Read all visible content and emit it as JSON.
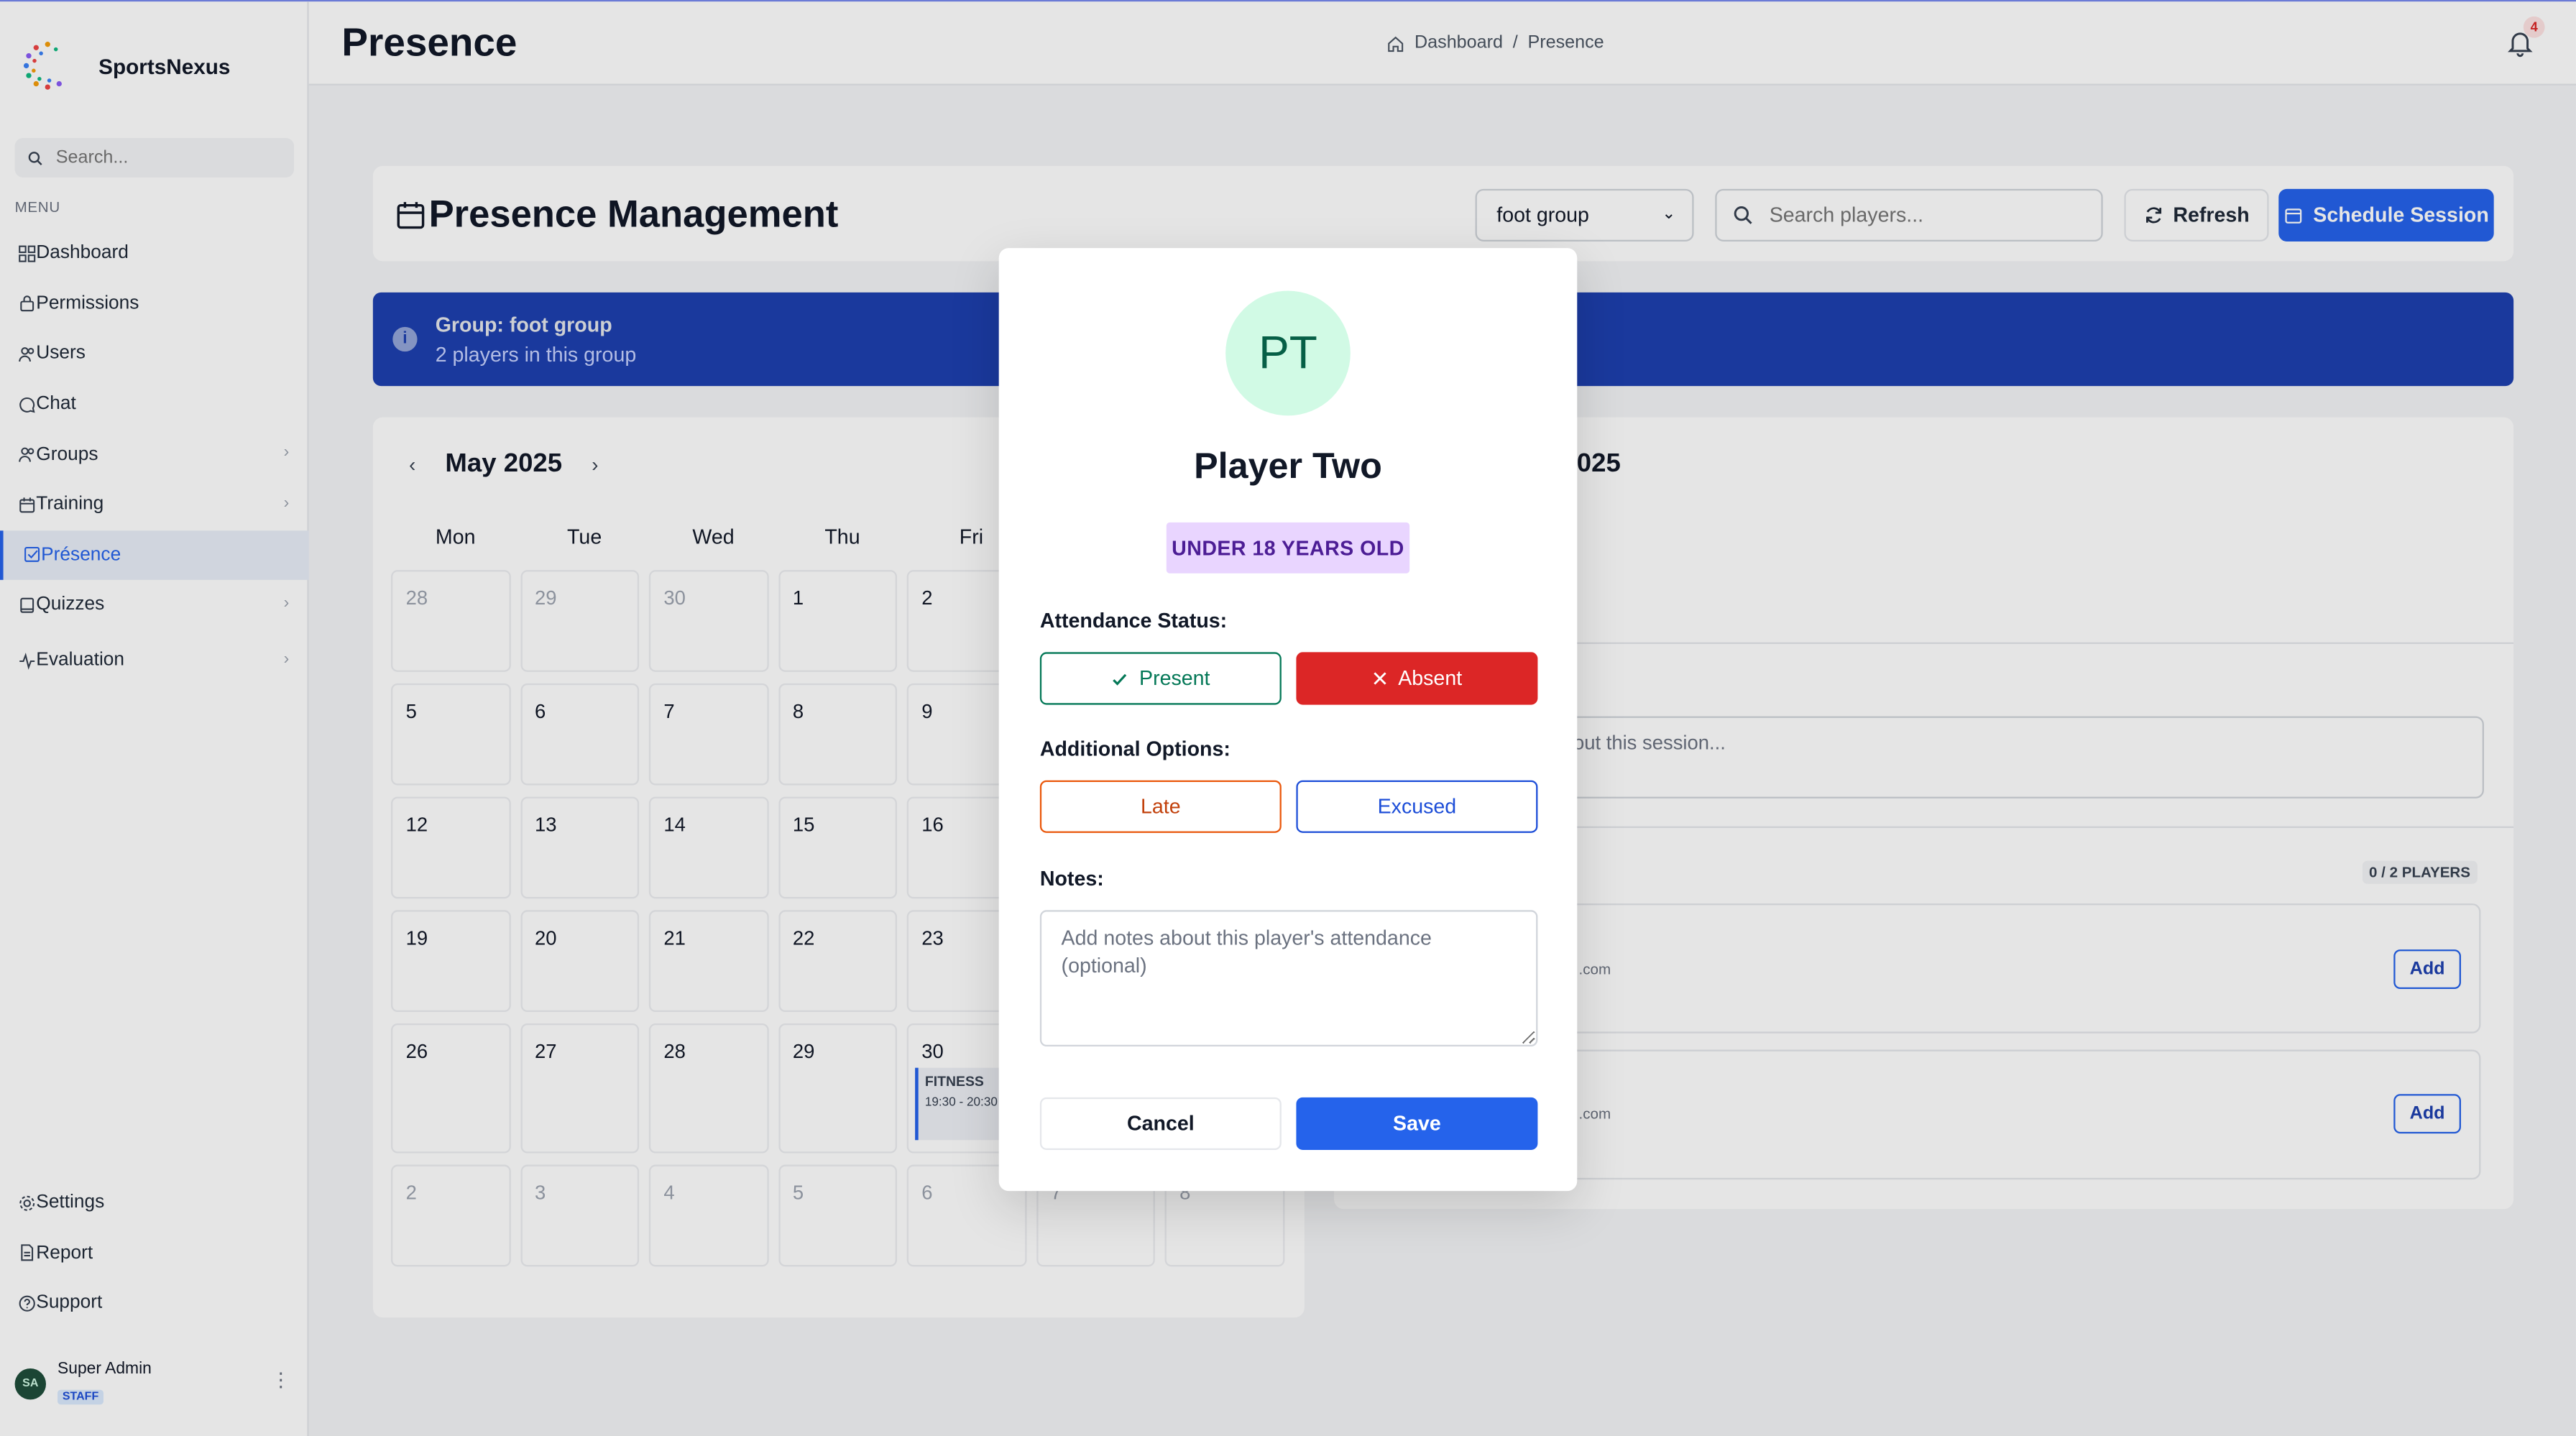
{
  "app": {
    "name": "SportsNexus"
  },
  "colors": {
    "accent": "#2563eb",
    "banner": "#1e40af",
    "danger": "#dc2626",
    "success": "#047857",
    "purple_badge": "#e9d5ff"
  },
  "sidebar": {
    "search_placeholder": "Search...",
    "menu_label": "MENU",
    "items": [
      {
        "label": "Dashboard",
        "icon": "dashboard-icon"
      },
      {
        "label": "Permissions",
        "icon": "lock-icon"
      },
      {
        "label": "Users",
        "icon": "users-icon"
      },
      {
        "label": "Chat",
        "icon": "chat-icon"
      },
      {
        "label": "Groups",
        "icon": "users-icon",
        "has_children": true
      },
      {
        "label": "Training",
        "icon": "calendar-icon",
        "has_children": true
      },
      {
        "label": "Présence",
        "icon": "check-square-icon",
        "active": true
      },
      {
        "label": "Quizzes",
        "icon": "book-icon",
        "has_children": true
      },
      {
        "label": "Evaluation",
        "icon": "activity-icon",
        "has_children": true
      }
    ],
    "bottom_items": [
      {
        "label": "Settings",
        "icon": "gear-icon"
      },
      {
        "label": "Report",
        "icon": "file-icon"
      },
      {
        "label": "Support",
        "icon": "help-icon"
      }
    ],
    "user": {
      "initials": "SA",
      "name": "Super Admin",
      "role": "STAFF"
    }
  },
  "header": {
    "title": "Presence",
    "breadcrumb": [
      "Dashboard",
      "Presence"
    ],
    "notification_count": "4"
  },
  "main": {
    "title": "Presence Management",
    "group_select": "foot group",
    "search_placeholder": "Search players...",
    "refresh_label": "Refresh",
    "schedule_label": "Schedule Session",
    "banner": {
      "title": "Group: foot group",
      "subtitle": "2 players in this group"
    }
  },
  "calendar": {
    "month": "May 2025",
    "weekdays": [
      "Mon",
      "Tue",
      "Wed",
      "Thu",
      "Fri"
    ],
    "weeks": [
      [
        "28",
        "29",
        "30",
        "1",
        "2",
        "",
        ""
      ],
      [
        "5",
        "6",
        "7",
        "8",
        "9",
        "",
        ""
      ],
      [
        "12",
        "13",
        "14",
        "15",
        "16",
        "",
        ""
      ],
      [
        "19",
        "20",
        "21",
        "22",
        "23",
        "",
        ""
      ],
      [
        "26",
        "27",
        "28",
        "29",
        "30",
        "",
        ""
      ],
      [
        "2",
        "3",
        "4",
        "5",
        "6",
        "7",
        "8"
      ]
    ],
    "event": {
      "title": "FITNESS",
      "time": "19:30 - 20:30"
    }
  },
  "session_panel": {
    "date_fragment": ", 2025",
    "notes_placeholder_fragment": "bout this session...",
    "players_count": "0 / 2 PLAYERS",
    "players": [
      {
        "email_fragment": ".com",
        "add_label": "Add"
      },
      {
        "email_fragment": ".com",
        "add_label": "Add"
      }
    ]
  },
  "modal": {
    "initials": "PT",
    "name": "Player Two",
    "age_badge": "UNDER 18 YEARS OLD",
    "attendance_label": "Attendance Status:",
    "present_label": "Present",
    "absent_label": "Absent",
    "additional_label": "Additional Options:",
    "late_label": "Late",
    "excused_label": "Excused",
    "notes_label": "Notes:",
    "notes_placeholder": "Add notes about this player's attendance (optional)",
    "notes_value": "",
    "cancel_label": "Cancel",
    "save_label": "Save"
  }
}
